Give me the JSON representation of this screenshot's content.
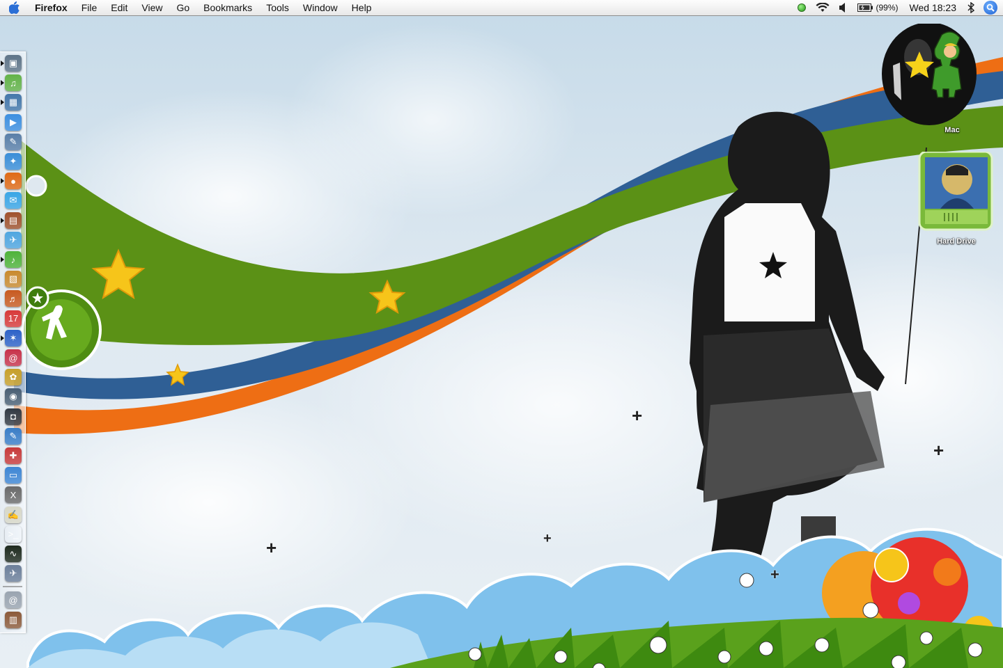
{
  "menubar": {
    "app_name": "Firefox",
    "menus": [
      "File",
      "Edit",
      "View",
      "Go",
      "Bookmarks",
      "Tools",
      "Window",
      "Help"
    ],
    "battery_percent": "(99%)",
    "clock": "Wed 18:23",
    "status_icons": [
      "status-green-dot-icon",
      "wifi-icon",
      "volume-icon",
      "battery-icon",
      "bluetooth-icon",
      "spotlight-icon"
    ]
  },
  "desktop": {
    "icons": [
      {
        "label": "Mac",
        "icon": "balloon-drive-icon"
      },
      {
        "label": "Hard Drive",
        "icon": "hard-drive-icon"
      }
    ]
  },
  "dock": {
    "icons": [
      {
        "name": "finder-icon",
        "color": "#5f7488",
        "glyph": "▣"
      },
      {
        "name": "itunes-icon",
        "color": "#63b348",
        "glyph": "♫"
      },
      {
        "name": "iphoto-icon",
        "color": "#4477aa",
        "glyph": "▦"
      },
      {
        "name": "quicktime-icon",
        "color": "#3d8fe0",
        "glyph": "▶"
      },
      {
        "name": "preview-icon",
        "color": "#5a7fa8",
        "glyph": "✎"
      },
      {
        "name": "safari-icon",
        "color": "#3a8ed8",
        "glyph": "✦"
      },
      {
        "name": "firefox-icon",
        "color": "#e06a16",
        "glyph": "●"
      },
      {
        "name": "ichat-icon",
        "color": "#3aa6e6",
        "glyph": "✉"
      },
      {
        "name": "photo-booth-icon",
        "color": "#a0522d",
        "glyph": "▤"
      },
      {
        "name": "mail-icon",
        "color": "#4fa6e0",
        "glyph": "✈"
      },
      {
        "name": "limewire-icon",
        "color": "#4fb33a",
        "glyph": "♪"
      },
      {
        "name": "stuffit-icon",
        "color": "#c98a2e",
        "glyph": "▧"
      },
      {
        "name": "garageband-icon",
        "color": "#c85a20",
        "glyph": "♬"
      },
      {
        "name": "ical-icon",
        "color": "#d83a3a",
        "glyph": "17"
      },
      {
        "name": "bluetooth-app-icon",
        "color": "#2e62c8",
        "glyph": "✶"
      },
      {
        "name": "address-book-icon",
        "color": "#c8324a",
        "glyph": "@"
      },
      {
        "name": "pineapple-icon",
        "color": "#c8a02a",
        "glyph": "✿"
      },
      {
        "name": "dashboard-icon",
        "color": "#4a5f74",
        "glyph": "◉"
      },
      {
        "name": "camera-icon",
        "color": "#333a44",
        "glyph": "◘"
      },
      {
        "name": "sketch-icon",
        "color": "#3a7ec8",
        "glyph": "✎"
      },
      {
        "name": "app-store-icon",
        "color": "#c83a3a",
        "glyph": "✚"
      },
      {
        "name": "window-icon",
        "color": "#3e86d4",
        "glyph": "▭"
      },
      {
        "name": "system-x-icon",
        "color": "#6a6a6a",
        "glyph": "X"
      },
      {
        "name": "text-edit-icon",
        "color": "#d8d8c8",
        "glyph": "✍"
      },
      {
        "name": "terminal-icon",
        "color": "#222",
        "glyph": ">_"
      },
      {
        "name": "activity-monitor-icon",
        "color": "#1e2a1e",
        "glyph": "∿"
      },
      {
        "name": "utilities-icon",
        "color": "#6c7f9a",
        "glyph": "✈"
      },
      {
        "name": "safari-downloads-icon",
        "color": "#9aa4b0",
        "glyph": "@"
      },
      {
        "name": "trash-icon",
        "color": "#8c5a3a",
        "glyph": "▥"
      }
    ]
  }
}
